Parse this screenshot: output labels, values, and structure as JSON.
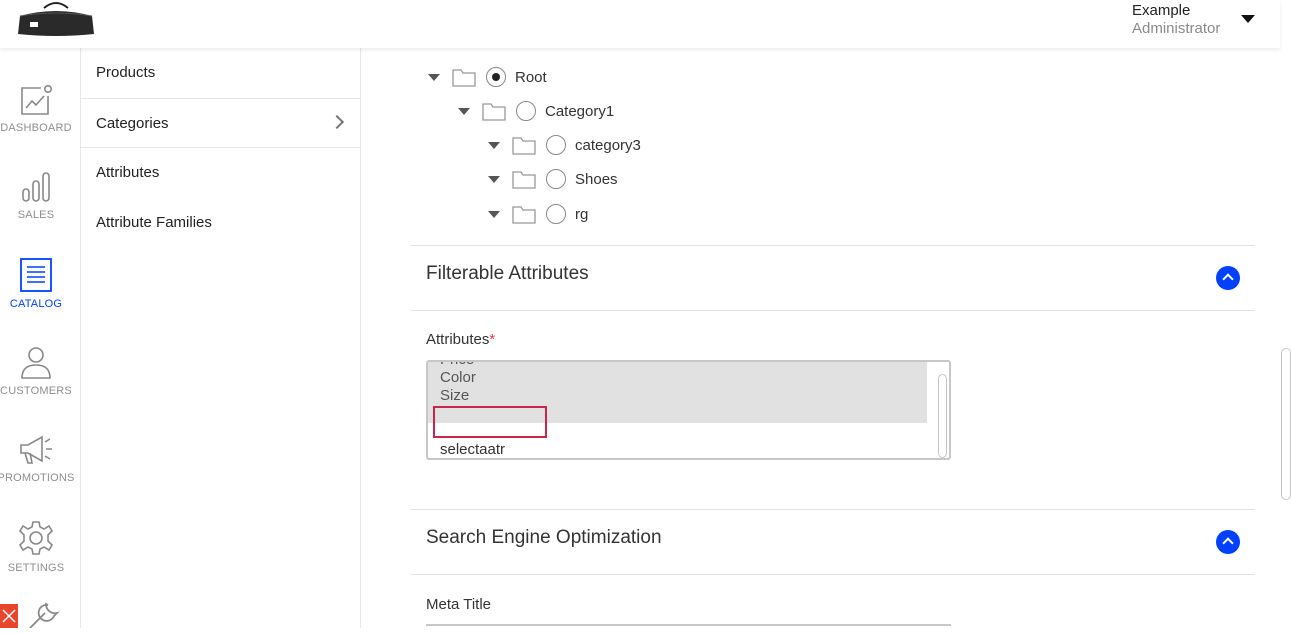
{
  "header": {
    "user_name": "Example",
    "user_role": "Administrator"
  },
  "nav": {
    "accent": "#0041ff",
    "items": [
      {
        "label": "DASHBOARD",
        "icon": "dashboard-icon"
      },
      {
        "label": "SALES",
        "icon": "sales-icon"
      },
      {
        "label": "CATALOG",
        "icon": "catalog-icon",
        "active": true
      },
      {
        "label": "CUSTOMERS",
        "icon": "customers-icon"
      },
      {
        "label": "PROMOTIONS",
        "icon": "promotions-icon"
      },
      {
        "label": "SETTINGS",
        "icon": "settings-icon"
      }
    ]
  },
  "submenu": {
    "items": [
      {
        "label": "Products"
      },
      {
        "label": "Categories",
        "active": true
      },
      {
        "label": "Attributes"
      },
      {
        "label": "Attribute Families"
      }
    ]
  },
  "tree": {
    "nodes": [
      {
        "label": "Root",
        "checked": true
      },
      {
        "label": "Category1",
        "checked": false
      },
      {
        "label": "category3",
        "checked": false
      },
      {
        "label": "Shoes",
        "checked": false
      },
      {
        "label": "rg",
        "checked": false
      }
    ]
  },
  "filterable": {
    "title": "Filterable Attributes",
    "attributes_label": "Attributes",
    "required_mark": "*",
    "options": [
      {
        "label": "Price",
        "selected": true
      },
      {
        "label": "Color",
        "selected": true
      },
      {
        "label": "Size",
        "selected": true
      },
      {
        "label": "",
        "selected": true
      },
      {
        "label": "",
        "selected": false
      },
      {
        "label": "selectaatr",
        "selected": false
      }
    ]
  },
  "seo": {
    "title": "Search Engine Optimization",
    "meta_title_label": "Meta Title"
  }
}
